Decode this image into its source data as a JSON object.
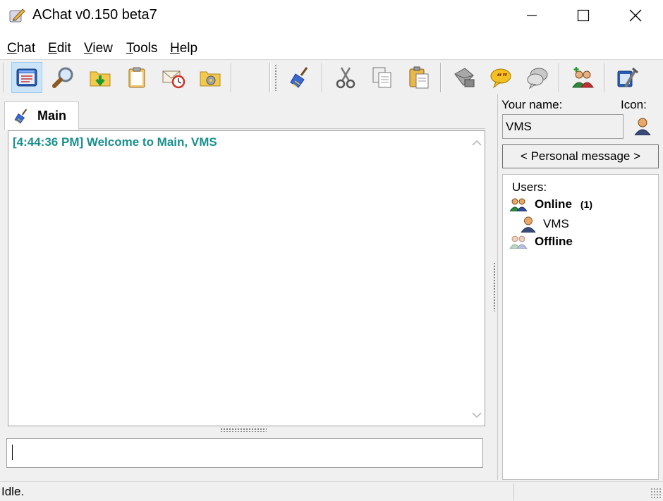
{
  "window": {
    "title": "AChat v0.150 beta7",
    "minimize_glyph": "—",
    "close_glyph": "✕"
  },
  "menu": {
    "items": [
      {
        "first": "C",
        "rest": "hat"
      },
      {
        "first": "E",
        "rest": "dit"
      },
      {
        "first": "V",
        "rest": "iew"
      },
      {
        "first": "T",
        "rest": "ools"
      },
      {
        "first": "H",
        "rest": "elp"
      }
    ]
  },
  "toolbar": {
    "icons": [
      "window-icon",
      "search-icon",
      "folder-download-icon",
      "clipboard-icon",
      "mail-clock-icon",
      "folder-settings-icon",
      "broom-icon",
      "cut-icon",
      "copy-icon",
      "paste-icon",
      "mail-send-icon",
      "chat-bubble-icon",
      "chat-bubble-gray-icon",
      "add-user-icon",
      "tools-icon"
    ]
  },
  "tab": {
    "label": "Main"
  },
  "chat": {
    "message": "[4:44:36 PM] Welcome to Main, VMS",
    "message_color": "#1a8f8f"
  },
  "profile": {
    "your_name_label": "Your name:",
    "icon_label": "Icon:",
    "name_value": "VMS",
    "personal_message_button": "< Personal message >"
  },
  "users": {
    "header": "Users:",
    "online_label": "Online",
    "online_count": "(1)",
    "online_users": [
      "VMS"
    ],
    "offline_label": "Offline"
  },
  "status": {
    "text": "Idle."
  },
  "colors": {
    "accent": "#1a8f8f",
    "active_button_bg": "#cce4f7"
  }
}
